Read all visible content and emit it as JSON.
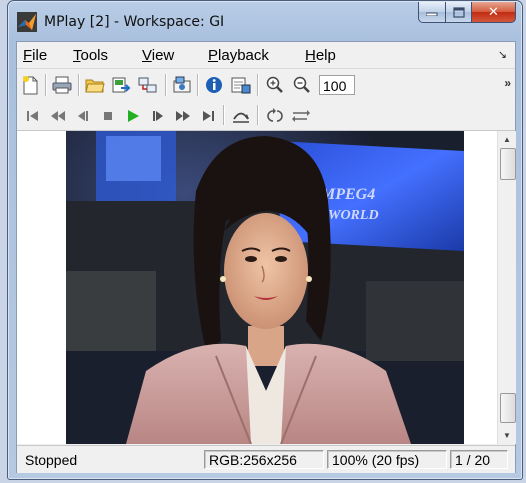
{
  "window": {
    "title": "MPlay [2] - Workspace: GI",
    "minimize_glyph": "—",
    "maximize_glyph": "□",
    "close_glyph": "✕"
  },
  "menu": {
    "items": [
      {
        "first": "F",
        "rest": "ile"
      },
      {
        "first": "T",
        "rest": "ools"
      },
      {
        "first": "V",
        "rest": "iew"
      },
      {
        "first": "P",
        "rest": "layback"
      },
      {
        "first": "H",
        "rest": "elp"
      }
    ],
    "overflow_glyph": "↘"
  },
  "toolbar": {
    "zoom_value": "100",
    "overflow_glyph": "»",
    "icons": [
      "new-icon",
      "print-icon",
      "open-folder-icon",
      "export-icon",
      "connect-icon",
      "snapshot-icon",
      "info-icon",
      "properties-icon",
      "zoom-in-icon",
      "zoom-out-icon"
    ]
  },
  "playback": {
    "icons": [
      "go-to-start-icon",
      "rewind-icon",
      "step-back-icon",
      "stop-icon",
      "play-icon",
      "step-forward-icon",
      "fast-forward-icon",
      "go-to-end-icon",
      "jump-to-icon",
      "loop-icon",
      "autoreverse-icon"
    ],
    "play_color": "#22b022"
  },
  "video": {
    "background_text_line1": "MPEG4",
    "background_text_line2": "WORLD"
  },
  "status": {
    "state": "Stopped",
    "color_format": "RGB:256x256",
    "zoom_rate": "100% (20 fps)",
    "frame": "1 / 20"
  }
}
